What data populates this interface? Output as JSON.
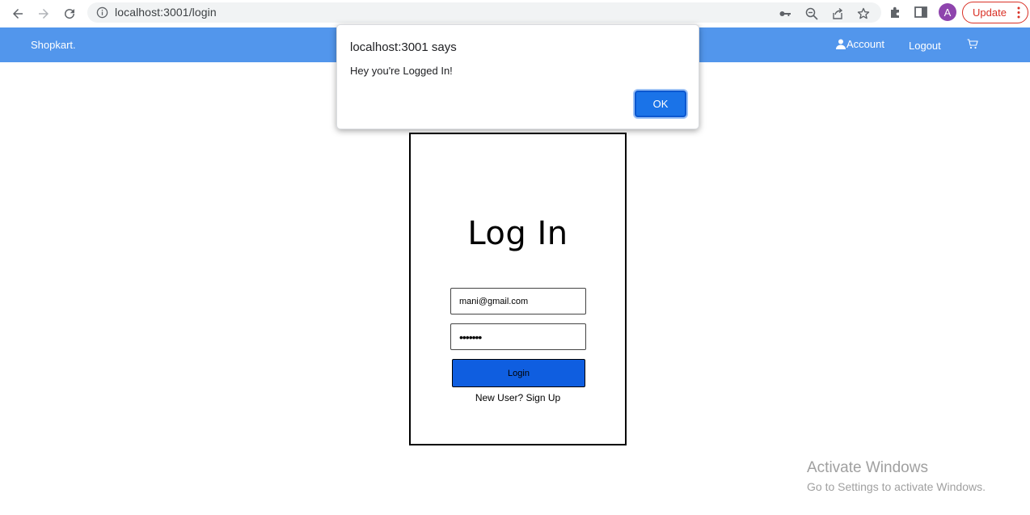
{
  "browser": {
    "url": "localhost:3001/login",
    "avatar_letter": "A",
    "update_label": "Update"
  },
  "nav": {
    "brand": "Shopkart.",
    "account": "Account",
    "logout": "Logout"
  },
  "dialog": {
    "title": "localhost:3001 says",
    "message": "Hey you're Logged In!",
    "ok": "OK"
  },
  "login": {
    "title": "Log In",
    "email_value": "mani@gmail.com",
    "password_mask": "•••••••",
    "button": "Login",
    "signup": "New User? Sign Up"
  },
  "watermark": {
    "line1": "Activate Windows",
    "line2": "Go to Settings to activate Windows."
  },
  "colors": {
    "nav_bg": "#5296ec",
    "login_btn": "#0f5ee0",
    "dialog_ok": "#1a73e8"
  }
}
